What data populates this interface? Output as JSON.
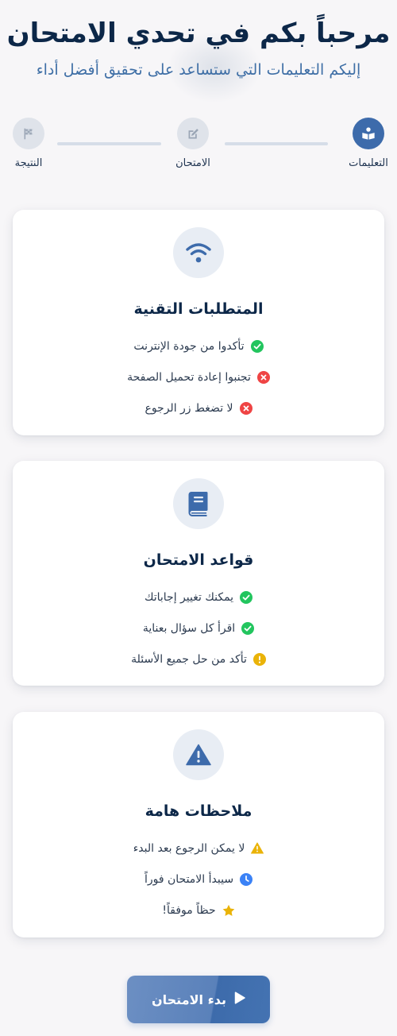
{
  "header": {
    "title": "مرحباً بكم في تحدي الامتحان",
    "subtitle": "إليكم التعليمات التي ستساعد على تحقيق أفضل أداء"
  },
  "stepper": {
    "steps": [
      {
        "label": "التعليمات",
        "icon": "book-reader-icon",
        "active": true
      },
      {
        "label": "الامتحان",
        "icon": "edit-icon",
        "active": false
      },
      {
        "label": "النتيجة",
        "icon": "checkered-flag-icon",
        "active": false
      }
    ]
  },
  "cards": [
    {
      "title": "المتطلبات التقنية",
      "icon": "wifi-icon",
      "items": [
        {
          "text": "تأكدوا من جودة الإنترنت",
          "icon": "check-circle-icon"
        },
        {
          "text": "تجنبوا إعادة تحميل الصفحة",
          "icon": "x-circle-icon"
        },
        {
          "text": "لا تضغط زر الرجوع",
          "icon": "x-circle-icon"
        }
      ]
    },
    {
      "title": "قواعد الامتحان",
      "icon": "book-icon",
      "items": [
        {
          "text": "يمكنك تغيير إجاباتك",
          "icon": "check-circle-icon"
        },
        {
          "text": "اقرأ كل سؤال بعناية",
          "icon": "check-circle-icon"
        },
        {
          "text": "تأكد من حل جميع الأسئلة",
          "icon": "exclamation-circle-icon"
        }
      ]
    },
    {
      "title": "ملاحظات هامة",
      "icon": "warning-icon",
      "items": [
        {
          "text": "لا يمكن الرجوع بعد البدء",
          "icon": "warning-triangle-icon"
        },
        {
          "text": "سيبدأ الامتحان فوراً",
          "icon": "clock-icon"
        },
        {
          "text": "حظاً موفقاً!",
          "icon": "star-icon"
        }
      ]
    }
  ],
  "start_button": {
    "label": "بدء الامتحان",
    "icon": "play-icon"
  },
  "colors": {
    "primary": "#3d6bab",
    "success": "#22c55e",
    "danger": "#ef4444",
    "warning": "#eab308",
    "info": "#3b82f6"
  }
}
